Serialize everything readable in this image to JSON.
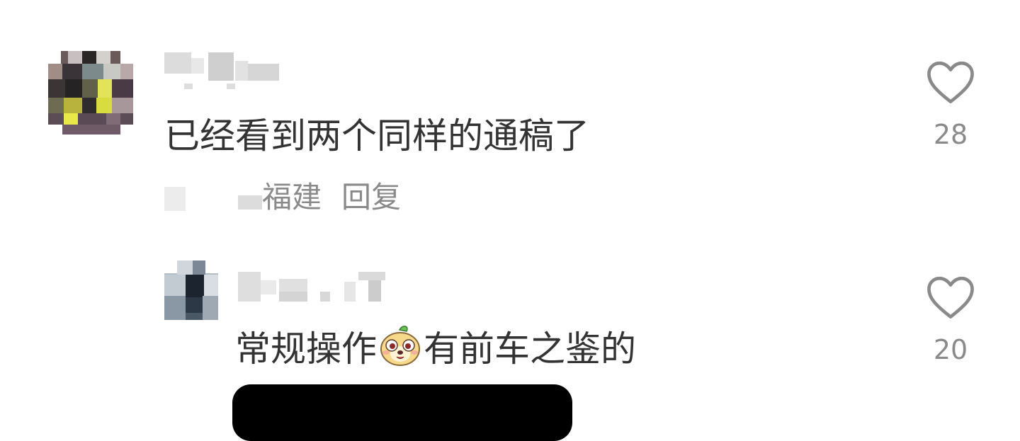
{
  "comments": [
    {
      "text": "已经看到两个同样的通稿了",
      "location": "福建",
      "reply_label": "回复",
      "likes": "28",
      "like_icon": "heart-outline-icon"
    },
    {
      "text_before": "常规操作",
      "emoji": "dog-face-emoji",
      "text_after": "有前车之鉴的",
      "likes": "20",
      "like_icon": "heart-outline-icon"
    }
  ]
}
